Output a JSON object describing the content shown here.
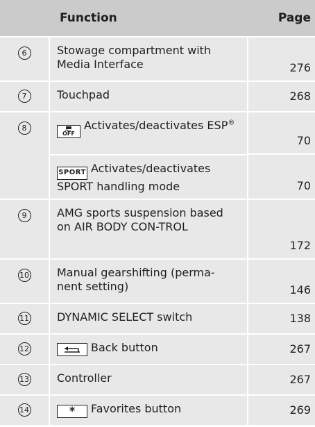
{
  "header": {
    "function_label": "Function",
    "page_label": "Page"
  },
  "rows": [
    {
      "num": "6",
      "text": "Stowage compartment with Media Interface",
      "page": "276"
    },
    {
      "num": "7",
      "text": "Touchpad",
      "page": "268"
    },
    {
      "num": "8",
      "sub": [
        {
          "icon": "esp-off-icon",
          "key_text": "OFF",
          "text": "Activates/deactivates ESP",
          "text_sup": "®",
          "page": "70"
        },
        {
          "icon": "sport-key-icon",
          "key_text": "SPORT",
          "text": "Activates/deactivates SPORT handling mode",
          "page": "70"
        }
      ]
    },
    {
      "num": "9",
      "text": "AMG sports suspension based on AIR BODY CON-TROL",
      "page": "172"
    },
    {
      "num": "10",
      "text": "Manual gearshifting (perma-nent setting)",
      "page": "146"
    },
    {
      "num": "11",
      "text": "DYNAMIC SELECT switch",
      "page": "138"
    },
    {
      "num": "12",
      "icon": "back-button-icon",
      "text": "Back button",
      "page": "267"
    },
    {
      "num": "13",
      "text": "Controller",
      "page": "267"
    },
    {
      "num": "14",
      "icon": "star-button-icon",
      "key_text": "*",
      "text": "Favorites button",
      "page": "269"
    }
  ]
}
